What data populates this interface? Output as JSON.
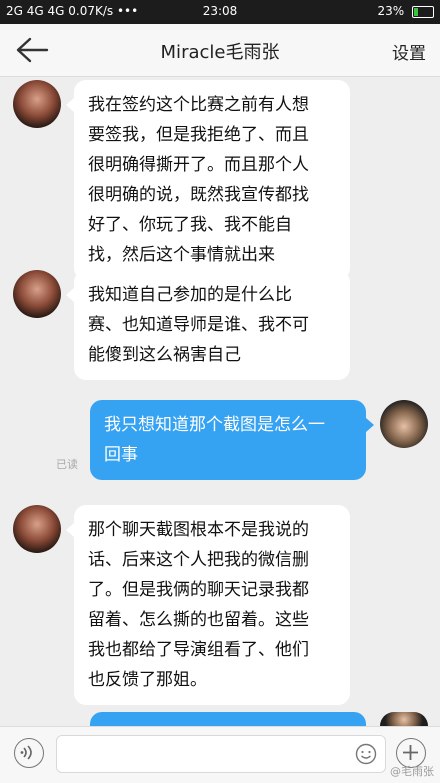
{
  "status_bar": {
    "left": "2G 4G 4G 0.07K/s •••",
    "time": "23:08",
    "battery": "23%",
    "battery_level": 0.23
  },
  "header": {
    "title": "Miracle毛雨张",
    "settings_label": "设置"
  },
  "messages": [
    {
      "side": "in",
      "text": "我在签约这个比赛之前有人想\n要签我，但是我拒绝了、而且\n很明确得撕开了。而且那个人\n很明确的说，既然我宣传都找\n好了、你玩了我、我不能自\n找，然后这个事情就出来"
    },
    {
      "side": "in",
      "text": "我知道自己参加的是什么比\n赛、也知道导师是谁、我不可\n能傻到这么祸害自己"
    },
    {
      "side": "out",
      "text": "我只想知道那个截图是怎么一\n回事",
      "status": "已读"
    },
    {
      "side": "in",
      "text": "那个聊天截图根本不是我说的\n话、后来这个人把我的微信删\n了。但是我俩的聊天记录我都\n留着、怎么撕的也留着。这些\n我也都给了导演组看了、他们\n也反馈了那姐。"
    }
  ],
  "watermark": "@毛雨张"
}
